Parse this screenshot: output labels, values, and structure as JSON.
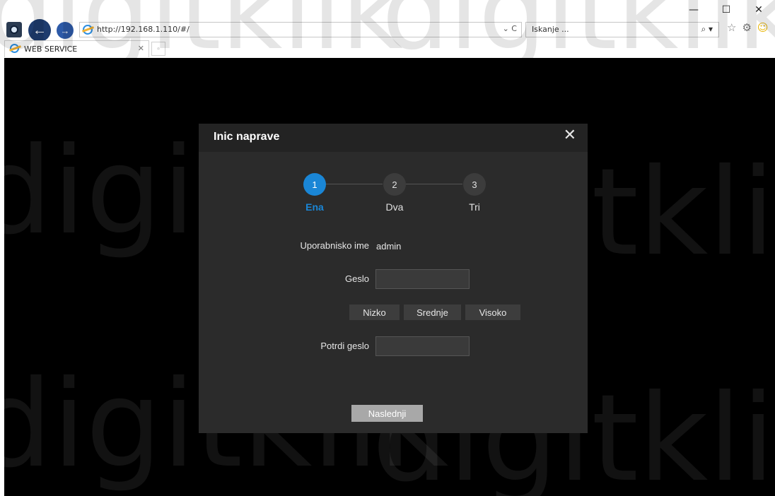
{
  "browser": {
    "url": "http://192.168.1.110/#/",
    "search_placeholder": "Iskanje ...",
    "tab_title": "WEB SERVICE",
    "window_controls": {
      "minimize": "—",
      "maximize": "☐",
      "close": "✕"
    },
    "addr_tools": "⌄ C",
    "search_icon": "⌕ ▾",
    "tab_close": "✕"
  },
  "watermark": "digitklik",
  "modal": {
    "title": "Inic naprave",
    "close": "✕",
    "steps": [
      {
        "number": "1",
        "label": "Ena",
        "active": true
      },
      {
        "number": "2",
        "label": "Dva",
        "active": false
      },
      {
        "number": "3",
        "label": "Tri",
        "active": false
      }
    ],
    "username_label": "Uporabnisko ime",
    "username_value": "admin",
    "password_label": "Geslo",
    "strength_levels": [
      "Nizko",
      "Srednje",
      "Visoko"
    ],
    "confirm_label": "Potrdi geslo",
    "next_button": "Naslednji"
  },
  "colors": {
    "accent": "#1a86d6",
    "modal_bg": "#2b2b2b",
    "page_bg": "#000000"
  }
}
